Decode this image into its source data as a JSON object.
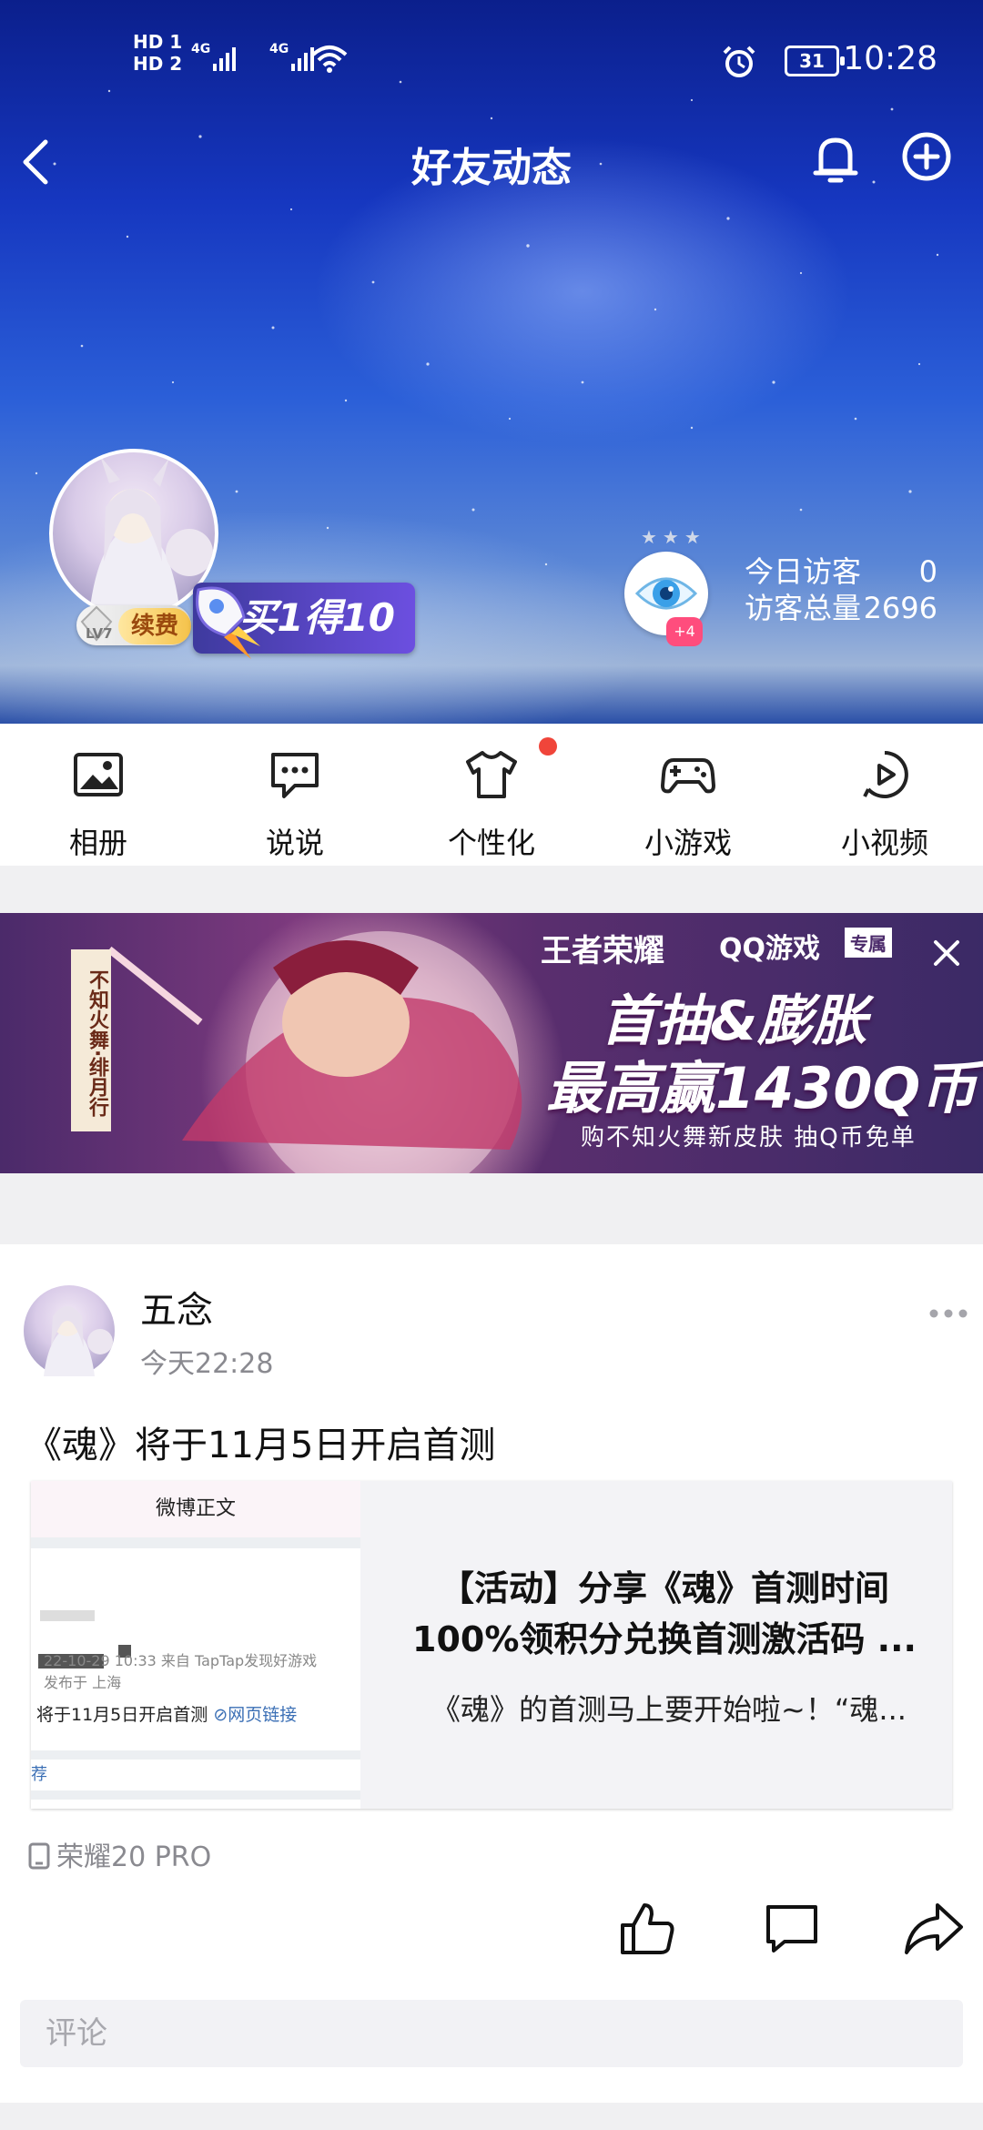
{
  "status_bar": {
    "hd1": "HD 1",
    "hd2": "HD 2",
    "net1": "4G",
    "net2": "4G",
    "battery": "31",
    "time": "10:28"
  },
  "nav": {
    "title": "好友动态",
    "icons": [
      "back-arrow-icon",
      "bell-icon",
      "add-circle-icon"
    ]
  },
  "profile": {
    "level": "LV7",
    "renew_label": "续费",
    "promo_label": "买1得10",
    "visitor_badge": "+4",
    "today_visitors_label": "今日访客",
    "today_visitors_value": "0",
    "total_visitors_label": "访客总量",
    "total_visitors_value": "2696"
  },
  "functions": [
    {
      "label": "相册",
      "icon": "album-icon"
    },
    {
      "label": "说说",
      "icon": "message-icon"
    },
    {
      "label": "个性化",
      "icon": "tshirt-icon"
    },
    {
      "label": "小游戏",
      "icon": "gamepad-icon"
    },
    {
      "label": "小视频",
      "icon": "video-icon"
    }
  ],
  "banner": {
    "brand": "王者荣耀",
    "partner": "QQ游戏",
    "partner_tag": "专属",
    "headline1": "首抽&膨胀",
    "headline2": "最高赢1430Q币",
    "sub": "购不知火舞新皮肤 抽Q币免单",
    "vertical_tag": "不知火舞·绯月行"
  },
  "post": {
    "author": "五念",
    "time": "今天22:28",
    "text": "《魂》将于11月5日开启首测",
    "card": {
      "thumb_header": "微博正文",
      "thumb_meta1": "22-10-29 10:33  来自 TapTap发现好游戏",
      "thumb_meta2": "发布于 上海",
      "thumb_line": "将于11月5日开启首测",
      "thumb_link": "网页链接",
      "thumb_rec": "荐",
      "title_line1": "【活动】分享《魂》首测时间",
      "title_line2": "100%领积分兑换首测激活码 ...",
      "desc": "《魂》的首测马上要开始啦~！“魂..."
    },
    "device": "荣耀20 PRO",
    "comment_placeholder": "评论"
  }
}
